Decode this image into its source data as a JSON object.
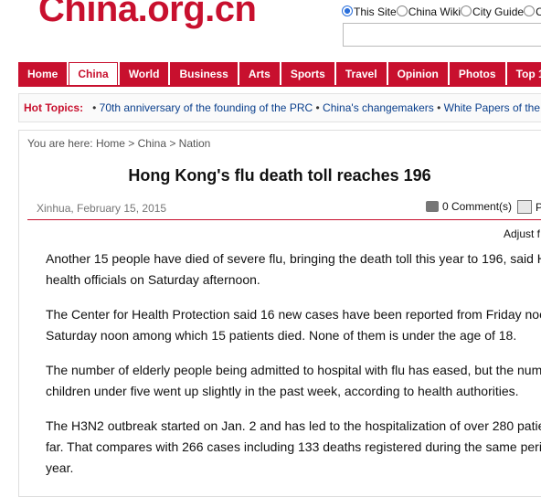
{
  "header": {
    "logo": "China.org.cn",
    "search_scope": [
      "This Site",
      "China Wiki",
      "City Guide",
      "C"
    ],
    "search_value": ""
  },
  "nav": {
    "tabs": [
      "Home",
      "China",
      "World",
      "Business",
      "Arts",
      "Sports",
      "Travel",
      "Opinion",
      "Photos",
      "Top 1"
    ],
    "active": "China"
  },
  "hot_topics": {
    "label": "Hot Topics:",
    "items": [
      "70th anniversary of the founding of the PRC",
      "China's changemakers",
      "White Papers of the"
    ]
  },
  "breadcrumb": "You are here: Home > China > Nation",
  "article": {
    "title": "Hong Kong's flu death toll reaches 196",
    "meta": "Xinhua, February 15, 2015",
    "comments": "0 Comment(s)",
    "print": "P",
    "adjust": "Adjust f",
    "lines": [
      "Another 15 people have died of severe flu, bringing the death toll this year to 196, said H",
      "health officials on Saturday afternoon.",
      "The Center for Health Protection said 16 new cases have been reported from Friday noo",
      "Saturday noon among which 15 patients died. None of them is under the age of 18.",
      "The number of elderly people being admitted to hospital with flu has eased, but the num",
      "children under five went up slightly in the past week, according to health authorities.",
      "The H3N2 outbreak started on Jan. 2 and has led to the hospitalization of over 280 patie",
      "far. That compares with 266 cases including 133 deaths registered during the same peri",
      "year."
    ]
  }
}
